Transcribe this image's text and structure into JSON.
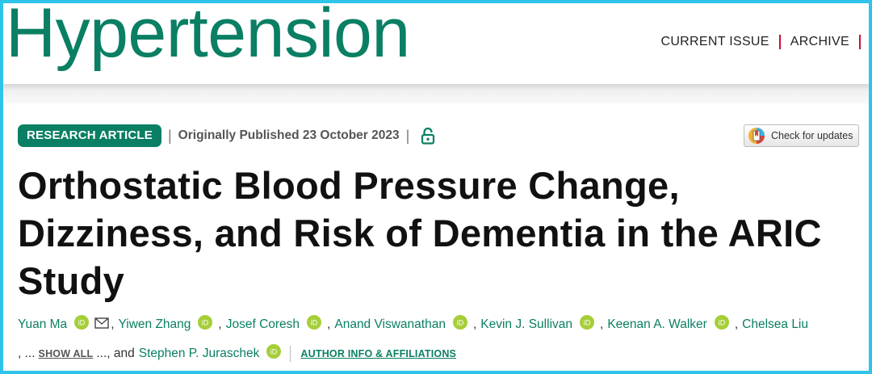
{
  "header": {
    "brand": "Hypertension",
    "nav": [
      "CURRENT ISSUE",
      "ARCHIVE"
    ]
  },
  "meta": {
    "article_type": "RESEARCH ARTICLE",
    "separator": "|",
    "published": "Originally Published 23 October 2023",
    "check_updates": "Check for updates"
  },
  "title": {
    "line1": "Orthostatic Blood Pressure Change,",
    "line2": "Dizziness, and Risk of Dementia in the ARIC",
    "line3": "Study"
  },
  "authors": {
    "names": [
      "Yuan Ma",
      "Yiwen Zhang",
      "Josef Coresh",
      "Anand Viswanathan",
      "Kevin J. Sullivan",
      "Keenan A. Walker",
      "Chelsea Liu"
    ],
    "comma": ",",
    "ellipsis_before": ", ...",
    "show_all": "SHOW ALL",
    "ellipsis_after": "..., and",
    "last_author": "Stephen P. Juraschek",
    "author_info": "AUTHOR INFO & AFFILIATIONS"
  },
  "colors": {
    "brand_green": "#0a7f63",
    "nav_separator": "#c8102e",
    "frame": "#2fc4ea",
    "orcid": "#a6ce39"
  },
  "icons": {
    "lock": "open-lock-icon",
    "orcid": "orcid-icon",
    "mail": "mail-icon",
    "crossmark": "crossmark-icon"
  }
}
